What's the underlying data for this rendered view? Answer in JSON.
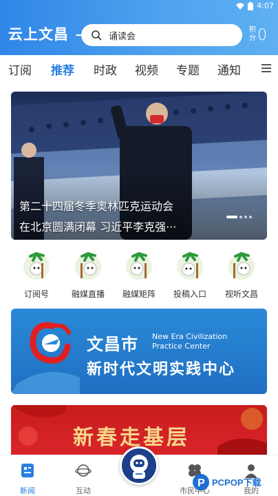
{
  "status_bar": {
    "time": "4:07"
  },
  "header": {
    "app_logo": "云上文昌",
    "search": {
      "text": "诵读会"
    },
    "points_label": "积分",
    "points_value": "0"
  },
  "tabs": [
    {
      "label": "订阅"
    },
    {
      "label": "推荐"
    },
    {
      "label": "时政"
    },
    {
      "label": "视频"
    },
    {
      "label": "专题"
    },
    {
      "label": "通知"
    }
  ],
  "hero": {
    "title_line1": "第二十四届冬季奥林匹克运动会",
    "title_line2": "在北京圆满闭幕 习近平李克强···"
  },
  "quick_entries": [
    {
      "label": "订阅号"
    },
    {
      "label": "融媒直播"
    },
    {
      "label": "融媒矩阵"
    },
    {
      "label": "投稿入口"
    },
    {
      "label": "视听文昌"
    }
  ],
  "banner": {
    "city": "文昌市",
    "en_line1": "New Era Civilization",
    "en_line2": "Practice Center",
    "cn": "新时代文明实践中心"
  },
  "banner2": {
    "text": "新春走基层"
  },
  "bottom_nav": [
    {
      "label": "新闻"
    },
    {
      "label": "互动"
    },
    {
      "label": "市民中心"
    },
    {
      "label": "我的"
    }
  ],
  "watermark": "PCPOP下载",
  "colors": {
    "accent": "#2a7fe0",
    "header": "#3a90e8"
  }
}
